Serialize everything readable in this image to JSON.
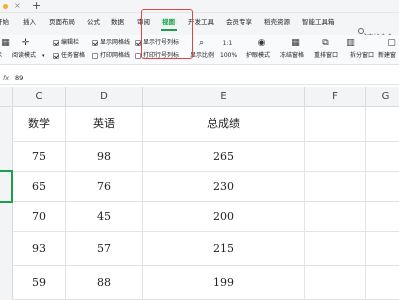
{
  "titlebar": {
    "close": "×",
    "new_tab": "+"
  },
  "menu": {
    "tabs": [
      "开始",
      "插入",
      "页面布局",
      "公式",
      "数据",
      "审阅",
      "视图",
      "开发工具",
      "会员专享",
      "稻壳资源",
      "智能工具箱"
    ],
    "active_tab": "视图",
    "search_text": "查找命令"
  },
  "ribbon": {
    "left_cut": "示",
    "reading_mode": "阅读模式",
    "edit_bar": "编辑栏",
    "task_pane": "任务窗格",
    "show_gridlines": "显示网格线",
    "print_gridlines": "打印网格线",
    "show_row_col": "显示行号列标",
    "print_row_col": "打印行号列标",
    "zoom_ratio": "显示比例",
    "zoom_label": "1:1",
    "zoom_pct": "100%",
    "eye_mode": "护眼模式",
    "freeze": "冻结窗格",
    "rearrange": "重排窗口",
    "split": "拆分窗口",
    "new_window": "新建窗"
  },
  "formula": {
    "fx": "fx",
    "value": "89"
  },
  "sheet": {
    "columns": [
      "C",
      "D",
      "E",
      "F",
      "G"
    ],
    "header_row": [
      "数学",
      "英语",
      "总成绩"
    ],
    "rows": [
      [
        "75",
        "98",
        "265"
      ],
      [
        "65",
        "76",
        "230"
      ],
      [
        "70",
        "45",
        "200"
      ],
      [
        "93",
        "57",
        "215"
      ],
      [
        "59",
        "88",
        "199"
      ]
    ]
  },
  "colors": {
    "accent": "#1f9d4e",
    "highlight": "#e0463e"
  }
}
